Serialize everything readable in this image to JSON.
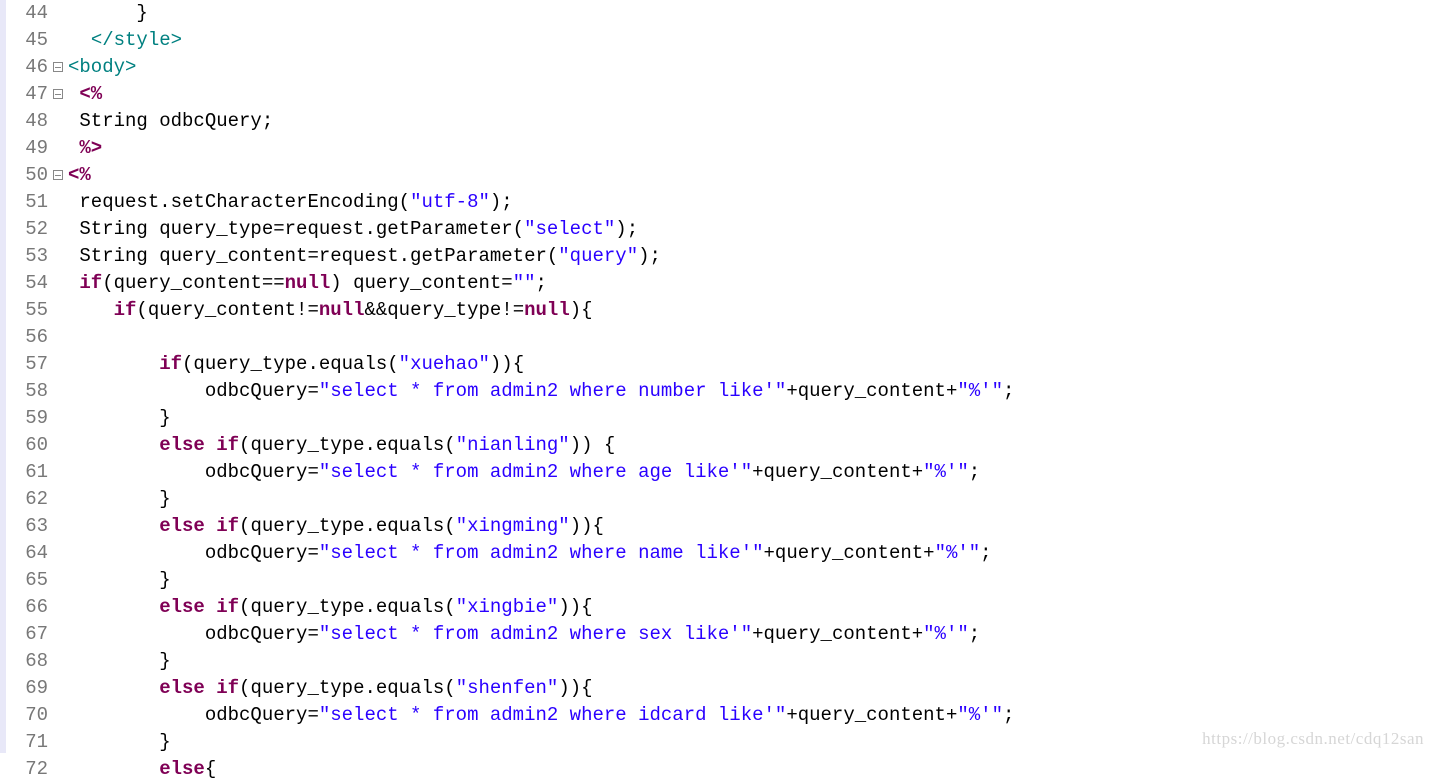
{
  "watermark": "https://blog.csdn.net/cdq12san",
  "lines": [
    {
      "n": 44,
      "fold": "",
      "tokens": [
        {
          "t": "      }",
          "c": ""
        }
      ]
    },
    {
      "n": 45,
      "fold": "",
      "tokens": [
        {
          "t": "  ",
          "c": ""
        },
        {
          "t": "</style>",
          "c": "tag"
        }
      ]
    },
    {
      "n": 46,
      "fold": "minus",
      "tokens": [
        {
          "t": "<body>",
          "c": "tag"
        }
      ]
    },
    {
      "n": 47,
      "fold": "minus",
      "tokens": [
        {
          "t": " ",
          "c": ""
        },
        {
          "t": "<%",
          "c": "kw"
        }
      ]
    },
    {
      "n": 48,
      "fold": "",
      "tokens": [
        {
          "t": " String odbcQuery;",
          "c": ""
        }
      ]
    },
    {
      "n": 49,
      "fold": "",
      "tokens": [
        {
          "t": " ",
          "c": ""
        },
        {
          "t": "%>",
          "c": "kw"
        }
      ]
    },
    {
      "n": 50,
      "fold": "minus",
      "tokens": [
        {
          "t": "<%",
          "c": "kw"
        }
      ]
    },
    {
      "n": 51,
      "fold": "",
      "tokens": [
        {
          "t": " request.setCharacterEncoding(",
          "c": ""
        },
        {
          "t": "\"utf-8\"",
          "c": "str"
        },
        {
          "t": ");",
          "c": ""
        }
      ]
    },
    {
      "n": 52,
      "fold": "",
      "tokens": [
        {
          "t": " String query_type=request.getParameter(",
          "c": ""
        },
        {
          "t": "\"select\"",
          "c": "str"
        },
        {
          "t": ");",
          "c": ""
        }
      ]
    },
    {
      "n": 53,
      "fold": "",
      "tokens": [
        {
          "t": " String query_content=request.getParameter(",
          "c": ""
        },
        {
          "t": "\"query\"",
          "c": "str"
        },
        {
          "t": ");",
          "c": ""
        }
      ]
    },
    {
      "n": 54,
      "fold": "",
      "tokens": [
        {
          "t": " ",
          "c": ""
        },
        {
          "t": "if",
          "c": "kw"
        },
        {
          "t": "(query_content==",
          "c": ""
        },
        {
          "t": "null",
          "c": "kw"
        },
        {
          "t": ") query_content=",
          "c": ""
        },
        {
          "t": "\"\"",
          "c": "str"
        },
        {
          "t": ";",
          "c": ""
        }
      ]
    },
    {
      "n": 55,
      "fold": "",
      "tokens": [
        {
          "t": "    ",
          "c": ""
        },
        {
          "t": "if",
          "c": "kw"
        },
        {
          "t": "(query_content!=",
          "c": ""
        },
        {
          "t": "null",
          "c": "kw"
        },
        {
          "t": "&&query_type!=",
          "c": ""
        },
        {
          "t": "null",
          "c": "kw"
        },
        {
          "t": "){",
          "c": ""
        }
      ]
    },
    {
      "n": 56,
      "fold": "",
      "tokens": [
        {
          "t": "",
          "c": ""
        }
      ]
    },
    {
      "n": 57,
      "fold": "",
      "tokens": [
        {
          "t": "        ",
          "c": ""
        },
        {
          "t": "if",
          "c": "kw"
        },
        {
          "t": "(query_type.equals(",
          "c": ""
        },
        {
          "t": "\"xuehao\"",
          "c": "str"
        },
        {
          "t": ")){",
          "c": ""
        }
      ]
    },
    {
      "n": 58,
      "fold": "",
      "tokens": [
        {
          "t": "            odbcQuery=",
          "c": ""
        },
        {
          "t": "\"select * from admin2 where number like'\"",
          "c": "str"
        },
        {
          "t": "+query_content+",
          "c": ""
        },
        {
          "t": "\"%'\"",
          "c": "str"
        },
        {
          "t": ";",
          "c": ""
        }
      ]
    },
    {
      "n": 59,
      "fold": "",
      "tokens": [
        {
          "t": "        }",
          "c": ""
        }
      ]
    },
    {
      "n": 60,
      "fold": "",
      "tokens": [
        {
          "t": "        ",
          "c": ""
        },
        {
          "t": "else",
          "c": "kw"
        },
        {
          "t": " ",
          "c": ""
        },
        {
          "t": "if",
          "c": "kw"
        },
        {
          "t": "(query_type.equals(",
          "c": ""
        },
        {
          "t": "\"nianling\"",
          "c": "str"
        },
        {
          "t": ")) {",
          "c": ""
        }
      ]
    },
    {
      "n": 61,
      "fold": "",
      "tokens": [
        {
          "t": "            odbcQuery=",
          "c": ""
        },
        {
          "t": "\"select * from admin2 where age like'\"",
          "c": "str"
        },
        {
          "t": "+query_content+",
          "c": ""
        },
        {
          "t": "\"%'\"",
          "c": "str"
        },
        {
          "t": ";",
          "c": ""
        }
      ]
    },
    {
      "n": 62,
      "fold": "",
      "tokens": [
        {
          "t": "        }",
          "c": ""
        }
      ]
    },
    {
      "n": 63,
      "fold": "",
      "tokens": [
        {
          "t": "        ",
          "c": ""
        },
        {
          "t": "else",
          "c": "kw"
        },
        {
          "t": " ",
          "c": ""
        },
        {
          "t": "if",
          "c": "kw"
        },
        {
          "t": "(query_type.equals(",
          "c": ""
        },
        {
          "t": "\"xingming\"",
          "c": "str"
        },
        {
          "t": ")){",
          "c": ""
        }
      ]
    },
    {
      "n": 64,
      "fold": "",
      "tokens": [
        {
          "t": "            odbcQuery=",
          "c": ""
        },
        {
          "t": "\"select * from admin2 where name like'\"",
          "c": "str"
        },
        {
          "t": "+query_content+",
          "c": ""
        },
        {
          "t": "\"%'\"",
          "c": "str"
        },
        {
          "t": ";",
          "c": ""
        }
      ]
    },
    {
      "n": 65,
      "fold": "",
      "tokens": [
        {
          "t": "        }",
          "c": ""
        }
      ]
    },
    {
      "n": 66,
      "fold": "",
      "tokens": [
        {
          "t": "        ",
          "c": ""
        },
        {
          "t": "else",
          "c": "kw"
        },
        {
          "t": " ",
          "c": ""
        },
        {
          "t": "if",
          "c": "kw"
        },
        {
          "t": "(query_type.equals(",
          "c": ""
        },
        {
          "t": "\"xingbie\"",
          "c": "str"
        },
        {
          "t": ")){",
          "c": ""
        }
      ]
    },
    {
      "n": 67,
      "fold": "",
      "tokens": [
        {
          "t": "            odbcQuery=",
          "c": ""
        },
        {
          "t": "\"select * from admin2 where sex like'\"",
          "c": "str"
        },
        {
          "t": "+query_content+",
          "c": ""
        },
        {
          "t": "\"%'\"",
          "c": "str"
        },
        {
          "t": ";",
          "c": ""
        }
      ]
    },
    {
      "n": 68,
      "fold": "",
      "tokens": [
        {
          "t": "        }",
          "c": ""
        }
      ]
    },
    {
      "n": 69,
      "fold": "",
      "tokens": [
        {
          "t": "        ",
          "c": ""
        },
        {
          "t": "else",
          "c": "kw"
        },
        {
          "t": " ",
          "c": ""
        },
        {
          "t": "if",
          "c": "kw"
        },
        {
          "t": "(query_type.equals(",
          "c": ""
        },
        {
          "t": "\"shenfen\"",
          "c": "str"
        },
        {
          "t": ")){",
          "c": ""
        }
      ]
    },
    {
      "n": 70,
      "fold": "",
      "tokens": [
        {
          "t": "            odbcQuery=",
          "c": ""
        },
        {
          "t": "\"select * from admin2 where idcard like'\"",
          "c": "str"
        },
        {
          "t": "+query_content+",
          "c": ""
        },
        {
          "t": "\"%'\"",
          "c": "str"
        },
        {
          "t": ";",
          "c": ""
        }
      ]
    },
    {
      "n": 71,
      "fold": "",
      "tokens": [
        {
          "t": "        }",
          "c": ""
        }
      ]
    },
    {
      "n": 72,
      "fold": "",
      "tokens": [
        {
          "t": "        ",
          "c": ""
        },
        {
          "t": "else",
          "c": "kw"
        },
        {
          "t": "{",
          "c": ""
        }
      ]
    }
  ]
}
